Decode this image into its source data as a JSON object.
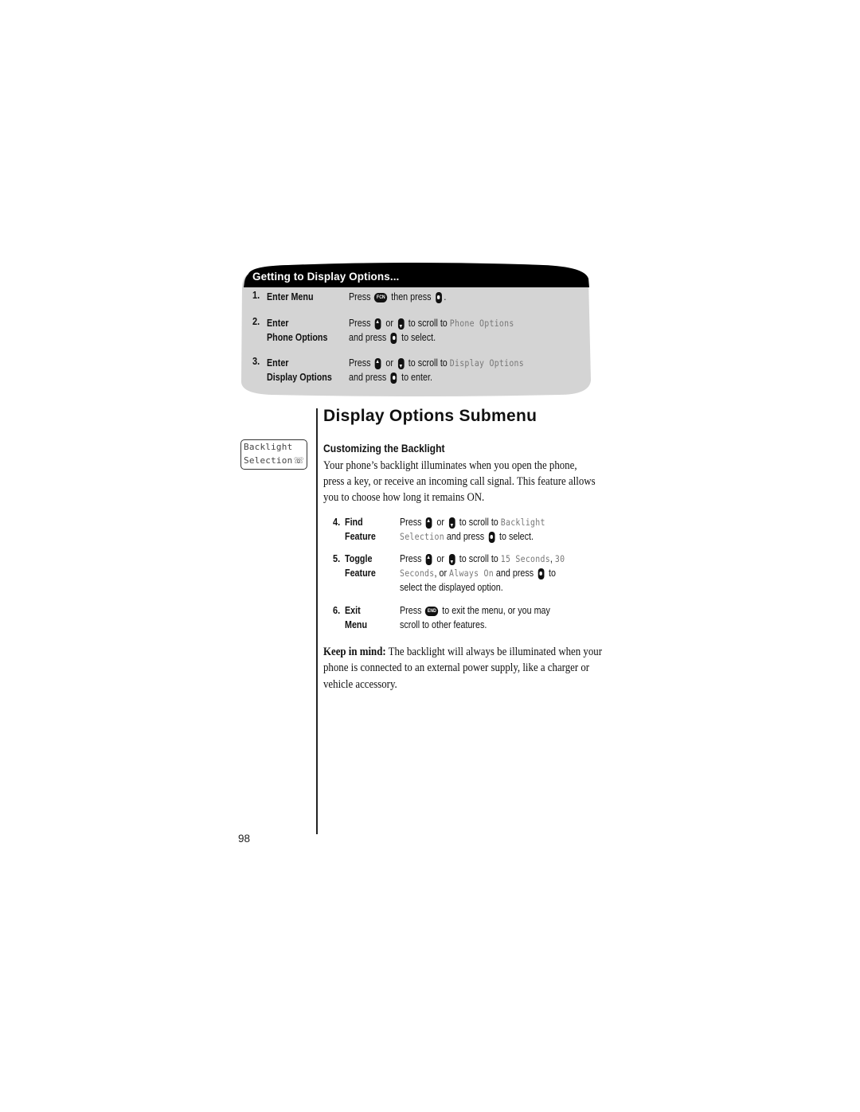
{
  "getting_box": {
    "title": "Getting to Display  Options...",
    "steps": [
      {
        "num": "1.",
        "label_lines": [
          "Enter Menu"
        ],
        "instruction_lines": [
          [
            {
              "t": "text",
              "v": "Press "
            },
            {
              "t": "key",
              "k": "fcn-key",
              "label": "FCN"
            },
            {
              "t": "text",
              "v": " then press "
            },
            {
              "t": "key",
              "k": "select-key"
            },
            {
              "t": "text",
              "v": "."
            }
          ]
        ]
      },
      {
        "num": "2.",
        "label_lines": [
          "Enter",
          "Phone Options"
        ],
        "instruction_lines": [
          [
            {
              "t": "text",
              "v": "Press "
            },
            {
              "t": "key",
              "k": "scroll-up-key"
            },
            {
              "t": "text",
              "v": " or "
            },
            {
              "t": "key",
              "k": "scroll-down-key"
            },
            {
              "t": "text",
              "v": " to scroll to "
            },
            {
              "t": "lcd",
              "v": "Phone Options"
            }
          ],
          [
            {
              "t": "text",
              "v": "and press "
            },
            {
              "t": "key",
              "k": "select-key"
            },
            {
              "t": "text",
              "v": " to select."
            }
          ]
        ]
      },
      {
        "num": "3.",
        "label_lines": [
          "Enter",
          "Display Options"
        ],
        "instruction_lines": [
          [
            {
              "t": "text",
              "v": "Press "
            },
            {
              "t": "key",
              "k": "scroll-up-key"
            },
            {
              "t": "text",
              "v": " or "
            },
            {
              "t": "key",
              "k": "scroll-down-key"
            },
            {
              "t": "text",
              "v": " to scroll to "
            },
            {
              "t": "lcd",
              "v": "Display Options"
            }
          ],
          [
            {
              "t": "text",
              "v": "and press "
            },
            {
              "t": "key",
              "k": "select-key"
            },
            {
              "t": "text",
              "v": " to enter."
            }
          ]
        ]
      }
    ]
  },
  "display_screen": {
    "line1": "Backlight",
    "line2": "Selection",
    "icon": "phone-icon"
  },
  "section": {
    "title": "Display Options Submenu",
    "subtitle": "Customizing the Backlight",
    "paragraph": "Your phone’s backlight illuminates when you open the phone, press a key, or receive an incoming call signal. This feature allows you to choose how long it remains ON."
  },
  "steps": [
    {
      "num": "4.",
      "label_lines": [
        "Find",
        "Feature"
      ],
      "instruction_lines": [
        [
          {
            "t": "text",
            "v": "Press "
          },
          {
            "t": "key",
            "k": "scroll-up-key"
          },
          {
            "t": "text",
            "v": " or "
          },
          {
            "t": "key",
            "k": "scroll-down-key"
          },
          {
            "t": "text",
            "v": " to scroll to "
          },
          {
            "t": "lcd",
            "v": "Backlight"
          }
        ],
        [
          {
            "t": "lcd",
            "v": "Selection"
          },
          {
            "t": "text",
            "v": " and press "
          },
          {
            "t": "key",
            "k": "select-key"
          },
          {
            "t": "text",
            "v": " to select."
          }
        ]
      ]
    },
    {
      "num": "5.",
      "label_lines": [
        "Toggle",
        "Feature"
      ],
      "instruction_lines": [
        [
          {
            "t": "text",
            "v": "Press "
          },
          {
            "t": "key",
            "k": "scroll-up-key"
          },
          {
            "t": "text",
            "v": " or "
          },
          {
            "t": "key",
            "k": "scroll-down-key"
          },
          {
            "t": "text",
            "v": " to scroll to "
          },
          {
            "t": "lcd",
            "v": "15 Seconds"
          },
          {
            "t": "text",
            "v": ", "
          },
          {
            "t": "lcd",
            "v": "30"
          }
        ],
        [
          {
            "t": "lcd",
            "v": "Seconds"
          },
          {
            "t": "text",
            "v": ", or "
          },
          {
            "t": "lcd",
            "v": "Always On"
          },
          {
            "t": "text",
            "v": " and press "
          },
          {
            "t": "key",
            "k": "select-key"
          },
          {
            "t": "text",
            "v": " to"
          }
        ],
        [
          {
            "t": "text",
            "v": "select the displayed option."
          }
        ]
      ]
    },
    {
      "num": "6.",
      "label_lines": [
        "Exit",
        "Menu"
      ],
      "instruction_lines": [
        [
          {
            "t": "text",
            "v": "Press "
          },
          {
            "t": "key",
            "k": "end-key",
            "label": "END"
          },
          {
            "t": "text",
            "v": " to exit the menu, or you may"
          }
        ],
        [
          {
            "t": "text",
            "v": "scroll to other features."
          }
        ]
      ]
    }
  ],
  "keep_in_mind": {
    "lead": "Keep in mind:",
    "text": " The backlight will always be illuminated when your phone is connected to an external power supply, like a charger or vehicle accessory."
  },
  "page_number": "98"
}
